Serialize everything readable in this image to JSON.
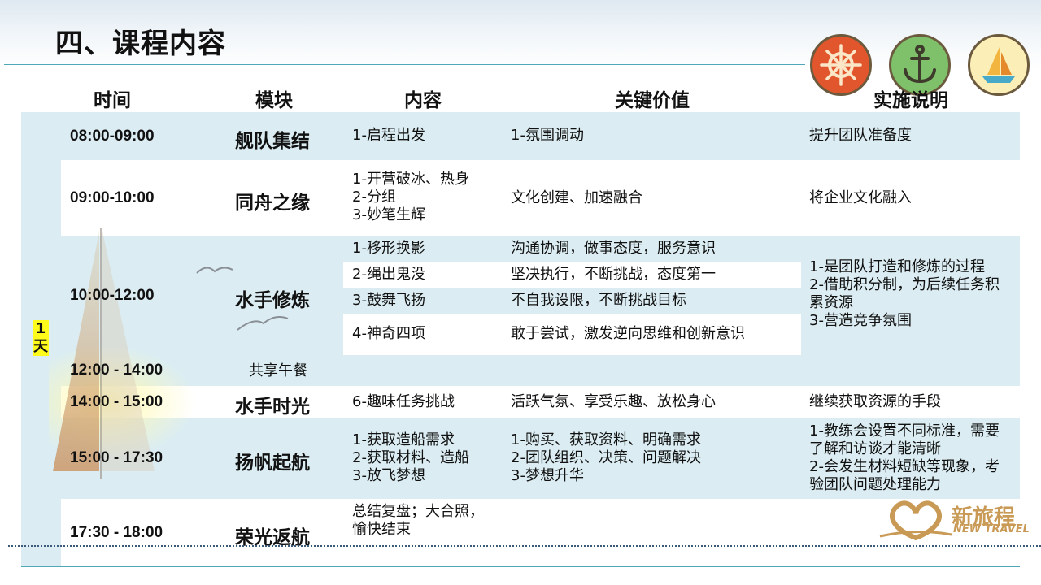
{
  "slide": {
    "title": "四、课程内容",
    "day_label": "1\n天"
  },
  "header": {
    "time": "时间",
    "module": "模块",
    "content": "内容",
    "value": "关键价值",
    "note": "实施说明"
  },
  "rows": [
    {
      "time": "08:00-09:00",
      "module": "舰队集结",
      "content": "1-启程出发",
      "value": "1-氛围调动",
      "note": "提升团队准备度"
    },
    {
      "time": "09:00-10:00",
      "module": "同舟之缘",
      "content": "1-开营破冰、热身\n2-分组\n3-妙笔生辉",
      "value": "文化创建、加速融合",
      "note": "将企业文化融入"
    },
    {
      "time": "10:00-12:00",
      "module": "水手修炼",
      "sub": [
        {
          "content": "1-移形换影",
          "value": "沟通协调，做事态度，服务意识"
        },
        {
          "content": "2-绳出鬼没",
          "value": "坚决执行，不断挑战，态度第一"
        },
        {
          "content": "3-鼓舞飞扬",
          "value": "不自我设限，不断挑战目标"
        },
        {
          "content": "4-神奇四项",
          "value": "敢于尝试，激发逆向思维和创新意识"
        }
      ],
      "note": "1-是团队打造和修炼的过程\n2-借助积分制，为后续任务积累资源\n3-营造竞争氛围"
    },
    {
      "time": "12:00 - 14:00",
      "module": "共享午餐"
    },
    {
      "time": "14:00 - 15:00",
      "module": "水手时光",
      "content": "6-趣味任务挑战",
      "value": "活跃气氛、享受乐趣、放松身心",
      "note": "继续获取资源的手段"
    },
    {
      "time": "15:00 - 17:30",
      "module": "扬帆起航",
      "content": "1-获取造船需求\n2-获取材料、造船\n3-放飞梦想",
      "value": "1-购买、获取资料、明确需求\n2-团队组织、决策、问题解决\n3-梦想升华",
      "note": "1-教练会设置不同标准，需要了解和访谈才能清晰\n2-会发生材料短缺等现象，考验团队问题处理能力"
    },
    {
      "time": "17:30 - 18:00",
      "module": "荣光返航",
      "content": "总结复盘；大合照，\n愉快结束"
    }
  ],
  "logo": {
    "name": "新旅程",
    "sub": "NEW TRAVEL"
  },
  "icons": [
    "ship-wheel-icon",
    "anchor-icon",
    "sailboat-icon"
  ],
  "colors": {
    "band": "#dbedf3",
    "accent_line": "#4fa7b8",
    "highlight": "#fffb1a",
    "logo": "#c99a55"
  }
}
